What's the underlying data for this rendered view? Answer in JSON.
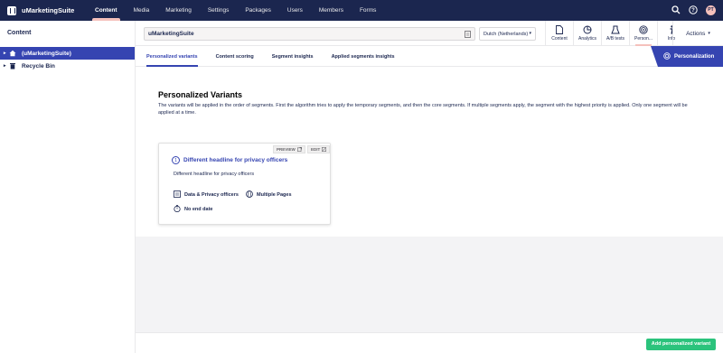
{
  "brand": {
    "name": "uMarketingSuite"
  },
  "nav": {
    "items": [
      "Content",
      "Media",
      "Marketing",
      "Settings",
      "Packages",
      "Users",
      "Members",
      "Forms"
    ],
    "active": "Content"
  },
  "user": {
    "initials": "PT"
  },
  "sidebar": {
    "title": "Content",
    "items": [
      {
        "label": "(uMarketingSuite)",
        "icon": "home-icon",
        "selected": true
      },
      {
        "label": "Recycle Bin",
        "icon": "trash-icon",
        "selected": false
      }
    ]
  },
  "header": {
    "name_value": "uMarketingSuite",
    "language": "Dutch (Netherlands)",
    "apps": [
      {
        "label": "Content",
        "icon": "document-icon"
      },
      {
        "label": "Analytics",
        "icon": "analytics-icon"
      },
      {
        "label": "A/B tests",
        "icon": "ab-test-icon"
      },
      {
        "label": "Person...",
        "icon": "target-icon",
        "active": true
      },
      {
        "label": "Info",
        "icon": "info-icon"
      }
    ],
    "actions_label": "Actions"
  },
  "subtabs": {
    "items": [
      "Personalized variants",
      "Content scoring",
      "Segment insights",
      "Applied segments insights"
    ],
    "active": "Personalized variants"
  },
  "badge": {
    "label": "Personalization"
  },
  "main": {
    "title": "Personalized Variants",
    "description": "The variants will be applied in the order of segments. First the algorithm tries to apply the temporary segments, and then the core segments. If multiple segments apply, the segment with the highest priority is applied. Only one segment will be applied at a time."
  },
  "card": {
    "preview_label": "PREVIEW",
    "edit_label": "EDIT",
    "number": "1",
    "title": "Different headline for privacy officers",
    "subtitle": "Different headline for privacy officers",
    "segment": "Data & Privacy officers",
    "pages": "Multiple Pages",
    "end_date": "No end date"
  },
  "footer": {
    "add_label": "Add personalized variant"
  },
  "colors": {
    "navy": "#1b264f",
    "accent": "#3544b1",
    "pink": "#f5c1bc",
    "green": "#2bc37c"
  }
}
